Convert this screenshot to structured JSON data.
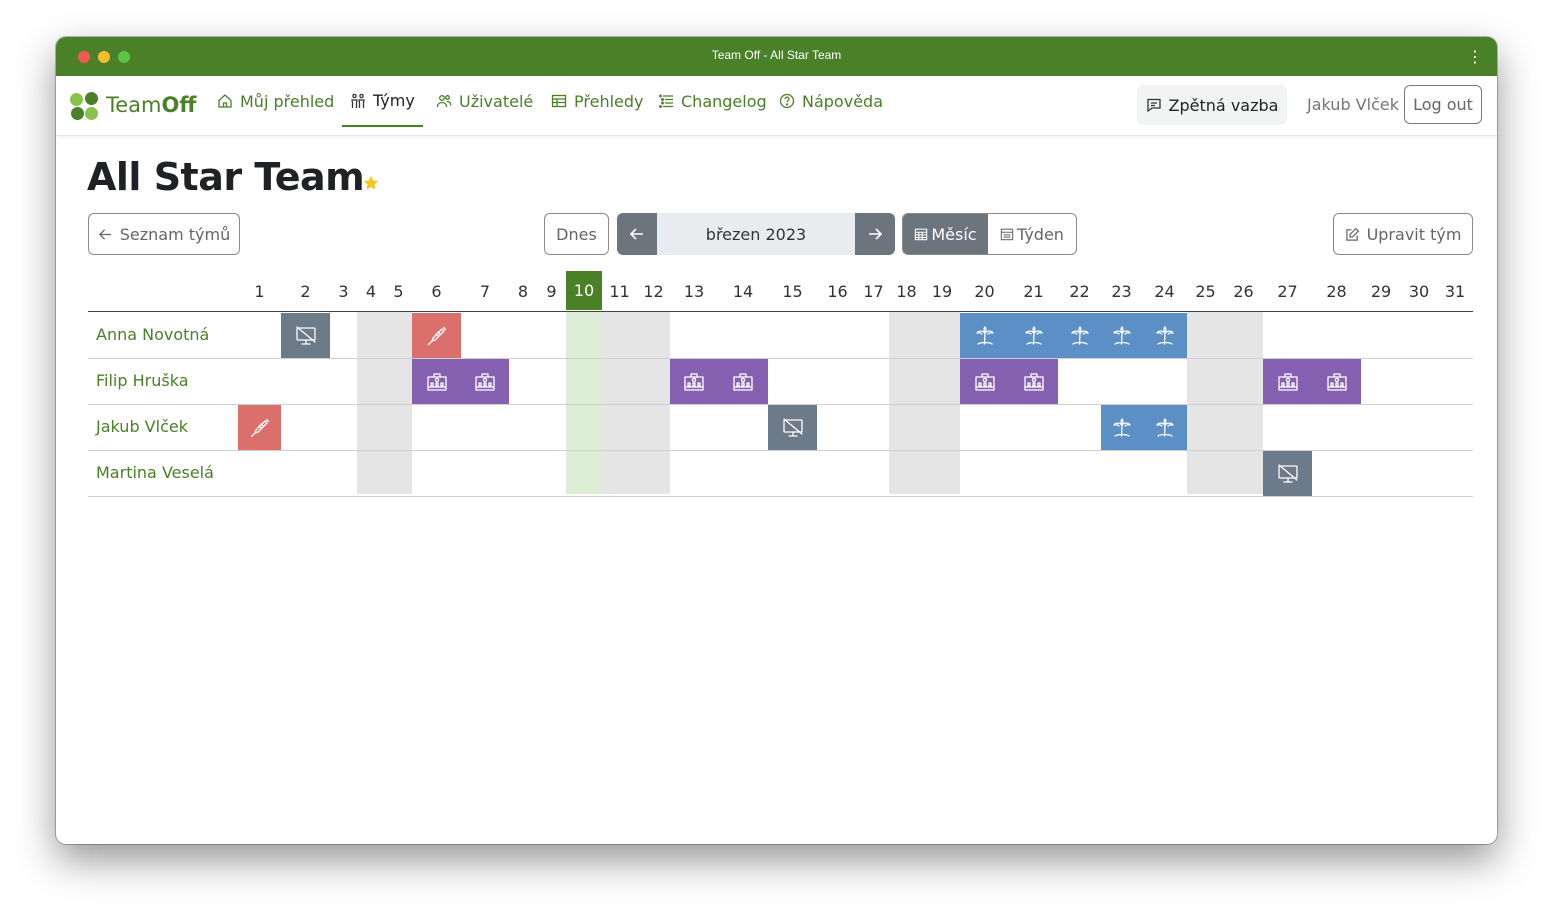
{
  "window": {
    "title": "Team Off - All Star Team",
    "menu_icon": "kebab-icon"
  },
  "brand": {
    "name_light": "Team",
    "name_bold": "Off",
    "colors": [
      "#8bc34a",
      "#4a8128"
    ]
  },
  "nav": {
    "items": [
      {
        "label": "Můj přehled",
        "icon": "home-icon"
      },
      {
        "label": "Týmy",
        "icon": "people-icon",
        "active": true
      },
      {
        "label": "Uživatelé",
        "icon": "users-icon"
      },
      {
        "label": "Přehledy",
        "icon": "table-icon"
      },
      {
        "label": "Changelog",
        "icon": "list-icon"
      },
      {
        "label": "Nápověda",
        "icon": "help-icon"
      }
    ],
    "feedback_label": "Zpětná vazba",
    "username": "Jakub Vlček",
    "logout_label": "Log out"
  },
  "page": {
    "title": "All Star Team",
    "favorite": true,
    "back_label": "Seznam týmů",
    "today_label": "Dnes",
    "month_label": "březen 2023",
    "view_month_label": "Měsíc",
    "view_week_label": "Týden",
    "view_selected": "month",
    "edit_label": "Upravit tým"
  },
  "colors": {
    "accent": "#4a8128",
    "weekend": "#e5e5e5",
    "today_column": "#dcefd6",
    "vacation": "#5b8fc6",
    "sick": "#db6f6b",
    "office": "#8660b0",
    "offline": "#6c7a89"
  },
  "calendar": {
    "days": [
      "1",
      "2",
      "3",
      "4",
      "5",
      "6",
      "7",
      "8",
      "9",
      "10",
      "11",
      "12",
      "13",
      "14",
      "15",
      "16",
      "17",
      "18",
      "19",
      "20",
      "21",
      "22",
      "23",
      "24",
      "25",
      "26",
      "27",
      "28",
      "29",
      "30",
      "31"
    ],
    "today": 10,
    "weekends": [
      4,
      5,
      11,
      12,
      18,
      19,
      25,
      26
    ],
    "people": [
      {
        "name": "Anna Novotná",
        "events": [
          {
            "day": 2,
            "type": "offline"
          },
          {
            "day": 6,
            "type": "sick"
          },
          {
            "day": 20,
            "type": "vacation"
          },
          {
            "day": 21,
            "type": "vacation"
          },
          {
            "day": 22,
            "type": "vacation"
          },
          {
            "day": 23,
            "type": "vacation"
          },
          {
            "day": 24,
            "type": "vacation"
          }
        ]
      },
      {
        "name": "Filip Hruška",
        "events": [
          {
            "day": 6,
            "type": "office"
          },
          {
            "day": 7,
            "type": "office"
          },
          {
            "day": 13,
            "type": "office"
          },
          {
            "day": 14,
            "type": "office"
          },
          {
            "day": 20,
            "type": "office"
          },
          {
            "day": 21,
            "type": "office"
          },
          {
            "day": 27,
            "type": "office"
          },
          {
            "day": 28,
            "type": "office"
          }
        ]
      },
      {
        "name": "Jakub Vlček",
        "events": [
          {
            "day": 1,
            "type": "sick"
          },
          {
            "day": 15,
            "type": "offline"
          },
          {
            "day": 23,
            "type": "vacation"
          },
          {
            "day": 24,
            "type": "vacation"
          }
        ]
      },
      {
        "name": "Martina Veselá",
        "events": [
          {
            "day": 27,
            "type": "offline"
          }
        ]
      }
    ]
  }
}
